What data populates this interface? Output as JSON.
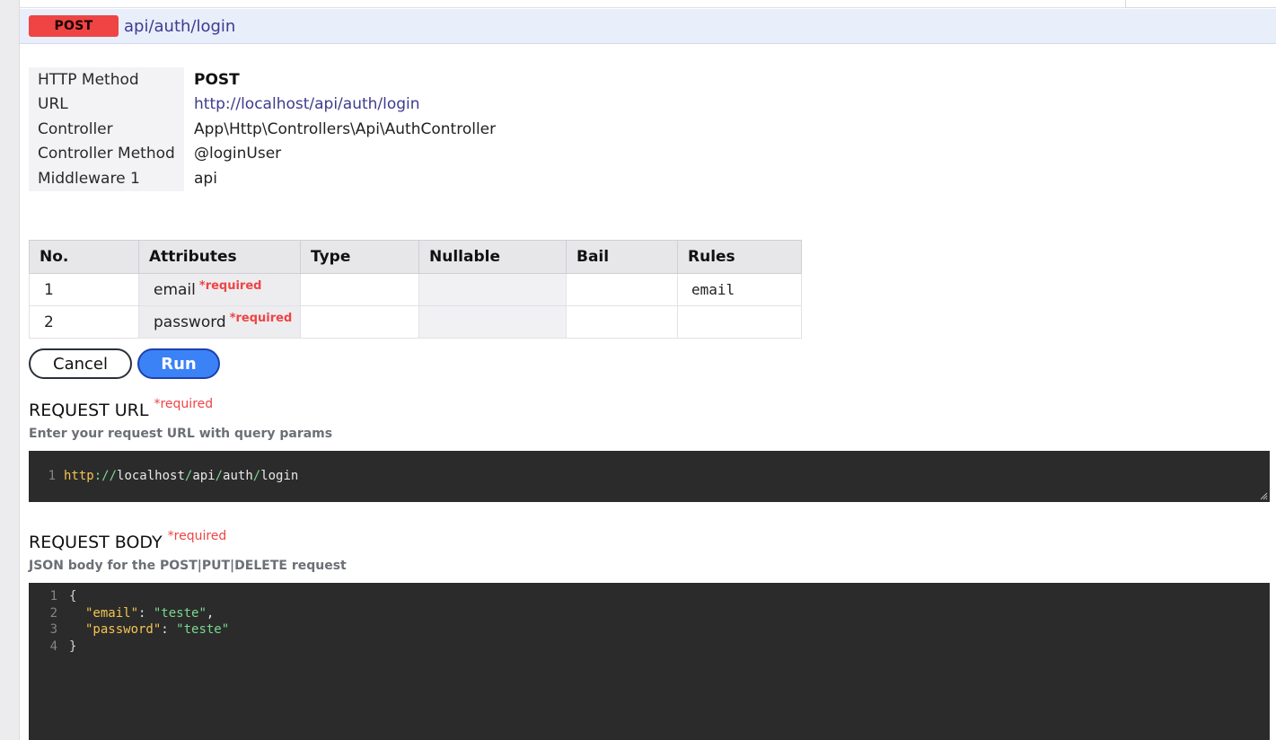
{
  "endpoint": {
    "method": "POST",
    "path": "api/auth/login"
  },
  "info": [
    {
      "key": "HTTP Method",
      "value": "POST"
    },
    {
      "key": "URL",
      "value": "http://localhost/api/auth/login"
    },
    {
      "key": "Controller",
      "value": "App\\Http\\Controllers\\Api\\AuthController"
    },
    {
      "key": "Controller Method",
      "value": "@loginUser"
    },
    {
      "key": "Middleware 1",
      "value": "api"
    }
  ],
  "attributes": {
    "headers": [
      "No.",
      "Attributes",
      "Type",
      "Nullable",
      "Bail",
      "Rules"
    ],
    "rows": [
      {
        "no": "1",
        "name": "email",
        "required": "*required",
        "type": "",
        "nullable": "",
        "bail": "",
        "rules": "email"
      },
      {
        "no": "2",
        "name": "password",
        "required": "*required",
        "type": "",
        "nullable": "",
        "bail": "",
        "rules": ""
      }
    ]
  },
  "buttons": {
    "cancel": "Cancel",
    "run": "Run"
  },
  "request_url": {
    "title": "REQUEST URL",
    "required": "*required",
    "subtitle": "Enter your request URL with query params",
    "line_numbers": [
      "1"
    ],
    "parts": {
      "scheme": "http",
      "sep1": "://",
      "host": "localhost",
      "sep2": "/",
      "seg1": "api",
      "sep3": "/",
      "seg2": "auth",
      "sep4": "/",
      "seg3": "login"
    }
  },
  "request_body": {
    "title": "REQUEST BODY",
    "required": "*required",
    "subtitle": "JSON body for the POST|PUT|DELETE request",
    "line_numbers": [
      "1",
      "2",
      "3",
      "4"
    ],
    "open_brace": "{",
    "close_brace": "}",
    "fields": [
      {
        "key": "\"email\"",
        "colon": ": ",
        "value": "\"teste\"",
        "trail": ","
      },
      {
        "key": "\"password\"",
        "colon": ": ",
        "value": "\"teste\"",
        "trail": ""
      }
    ]
  },
  "colors": {
    "method_badge": "#ef4444",
    "run_button": "#3b82f6",
    "required": "#ef4444",
    "editor_bg": "#2b2b2b",
    "header_bg": "#e9eefb"
  }
}
